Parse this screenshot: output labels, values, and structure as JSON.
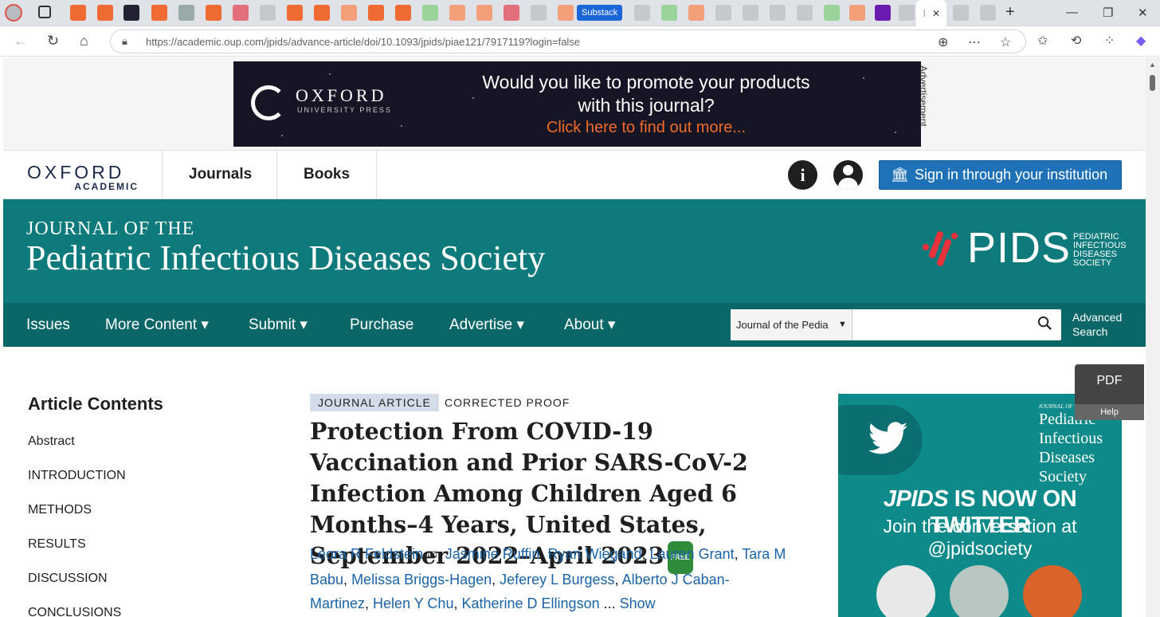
{
  "browser": {
    "active_tab_label": "I",
    "substack_tab_label": "Substack",
    "url": "https://academic.oup.com/jpids/advance-article/doi/10.1093/jpids/piae121/7917119?login=false",
    "new_tab_glyph": "+",
    "minimize_glyph": "—",
    "maximize_glyph": "❐",
    "close_glyph": "✕",
    "tab_close_glyph": "✕"
  },
  "ad": {
    "brand": "OXFORD",
    "brand_sub": "UNIVERSITY PRESS",
    "headline_line1": "Would you like to promote your products",
    "headline_line2": "with this journal?",
    "cta": "Click here to find out more...",
    "label": "Advertisement"
  },
  "oxford_nav": {
    "logo_top": "OXFORD",
    "logo_bottom": "ACADEMIC",
    "links": [
      "Journals",
      "Books"
    ],
    "info_glyph": "i",
    "signin_label": "Sign in through your institution"
  },
  "journal": {
    "line1": "JOURNAL OF THE",
    "line2": "Pediatric Infectious Diseases Society",
    "pids": "PIDS",
    "pids_sub": [
      "PEDIATRIC",
      "INFECTIOUS",
      "DISEASES",
      "SOCIETY"
    ],
    "brand_color": "#0e7a7c"
  },
  "journal_nav": {
    "items": [
      "Issues",
      "More Content ▾",
      "Submit ▾",
      "Purchase",
      "Advertise ▾",
      "About ▾"
    ],
    "search_scope": "Journal of the Pedia",
    "search_value": "",
    "advanced_line1": "Advanced",
    "advanced_line2": "Search"
  },
  "sidebar": {
    "title": "Article Contents",
    "items": [
      "Abstract",
      "INTRODUCTION",
      "METHODS",
      "RESULTS",
      "DISCUSSION",
      "CONCLUSIONS"
    ]
  },
  "article": {
    "type": "JOURNAL ARTICLE",
    "status": "CORRECTED PROOF",
    "title": "Protection From COVID-19 Vaccination and Prior SARS-CoV-2 Infection Among Children Aged 6 Months–4 Years, United States, September 2022–April 2023",
    "free_badge": "FREE",
    "authors": [
      "Leora R Feldstein",
      "Jasmine Ruffin",
      "Ryan Wiegand",
      "Lauren Grant",
      "Tara M Babu",
      "Melissa Briggs-Hagen",
      "Jeferey L Burgess",
      "Alberto J Caban-Martinez",
      "Helen Y Chu",
      "Katherine D Ellingson"
    ],
    "ellipsis": "...",
    "show_more": "Show"
  },
  "twitter_ad": {
    "journal_small": "JOURNAL OF THE",
    "journal_lines": [
      "Pediatric",
      "Infectious",
      "Diseases",
      "Society"
    ],
    "headline_italic": "JPIDS",
    "headline_rest": " IS NOW ON TWITTER",
    "sub_line1": "Join the conversation at",
    "sub_line2": "@jpidsociety"
  },
  "pdf_widget": {
    "label": "PDF",
    "help": "Help"
  }
}
